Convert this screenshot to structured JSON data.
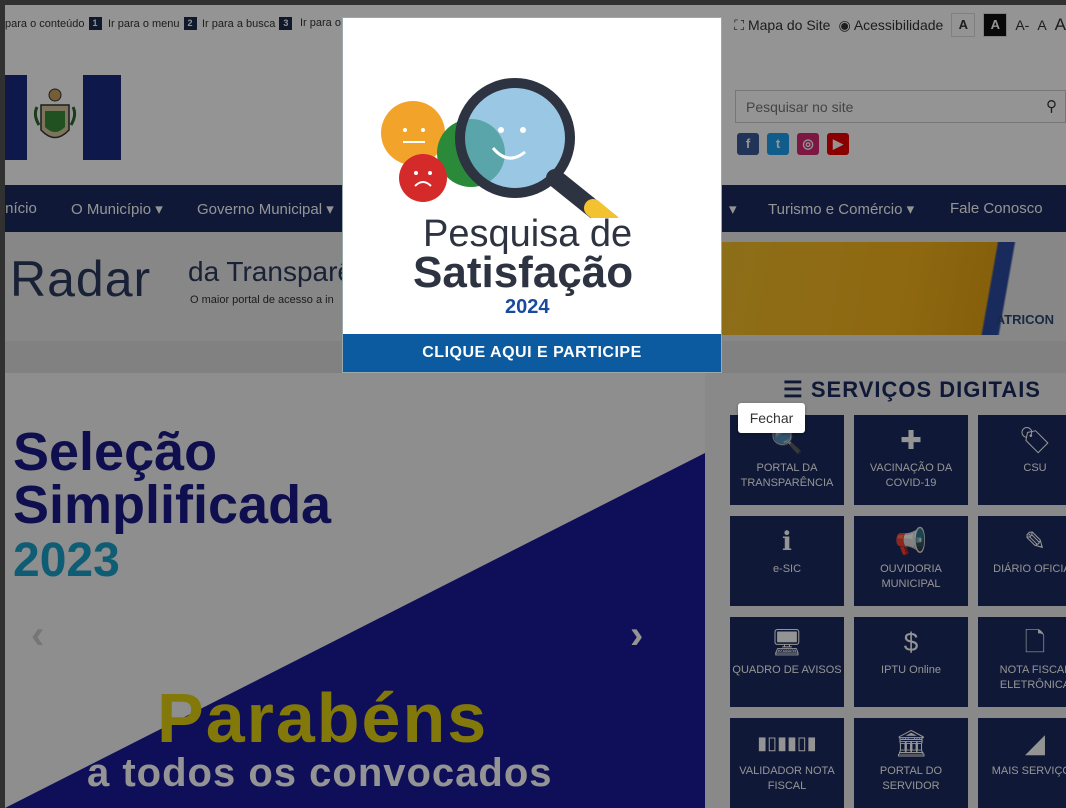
{
  "accessibility_bar": {
    "skip_links": [
      {
        "label": "para o conteúdo",
        "key": "1"
      },
      {
        "label": "Ir para o menu",
        "key": "2"
      },
      {
        "label": "Ir para a busca",
        "key": "3"
      },
      {
        "label": "Ir para o"
      }
    ],
    "sitemap": "Mapa do Site",
    "accessibility": "Acessibilidade",
    "contrast_light": "A",
    "contrast_dark": "A",
    "font_decrease": "A-",
    "font_normal": "A",
    "font_increase": "A"
  },
  "header": {
    "search_placeholder": "Pesquisar no site",
    "social": [
      "facebook-icon",
      "twitter-icon",
      "instagram-icon",
      "youtube-icon"
    ]
  },
  "nav": {
    "items": [
      "Início",
      "O Município",
      "Governo Municipal",
      "Turismo e Comércio",
      "Fale Conosco"
    ],
    "dropdown_marker": "▾"
  },
  "banner": {
    "title": "Radar",
    "subtitle": "da Transparê",
    "tagline": "O maior portal de acesso a in",
    "partner": "ATRICON"
  },
  "slider": {
    "line1": "Seleção",
    "line2": "Simplificada",
    "line3": "2023",
    "line4": "Parabéns",
    "line5": "a todos os convocados",
    "prev": "‹",
    "next": "›"
  },
  "services": {
    "title": "SERVIÇOS DIGITAIS",
    "tiles": [
      {
        "label": "PORTAL DA TRANSPARÊNCIA",
        "icon": "search-icon",
        "glyph": "🔍"
      },
      {
        "label": "VACINAÇÃO DA COVID-19",
        "icon": "medkit-icon",
        "glyph": "✚"
      },
      {
        "label": "CSU",
        "icon": "tag-icon",
        "glyph": "🏷"
      },
      {
        "label": "e-SIC",
        "icon": "info-icon",
        "glyph": "ℹ"
      },
      {
        "label": "OUVIDORIA MUNICIPAL",
        "icon": "megaphone-icon",
        "glyph": "📢"
      },
      {
        "label": "DIÁRIO OFICIAL",
        "icon": "document-edit-icon",
        "glyph": "✎"
      },
      {
        "label": "QUADRO DE AVISOS",
        "icon": "monitor-icon",
        "glyph": "🖥"
      },
      {
        "label": "IPTU Online",
        "icon": "dollar-icon",
        "glyph": "$"
      },
      {
        "label": "NOTA FISCAL ELETRÔNICA",
        "icon": "file-icon",
        "glyph": "🗋"
      },
      {
        "label": "VALIDADOR NOTA FISCAL",
        "icon": "barcode-icon",
        "glyph": "▮▯▮▮▯▮"
      },
      {
        "label": "PORTAL DO SERVIDOR",
        "icon": "bank-icon",
        "glyph": "🏛"
      },
      {
        "label": "MAIS SERVIÇOS",
        "icon": "chart-icon",
        "glyph": "◢"
      }
    ]
  },
  "modal": {
    "title_line1": "Pesquisa de",
    "title_line2": "Satisfação",
    "year": "2024",
    "cta": "CLIQUE AQUI E PARTICIPE",
    "close_tooltip": "Fechar"
  },
  "colors": {
    "navy": "#1a2a5e",
    "cta_blue": "#0c5aa0",
    "yellow": "#e2d112",
    "cyan": "#1aa0c8"
  }
}
